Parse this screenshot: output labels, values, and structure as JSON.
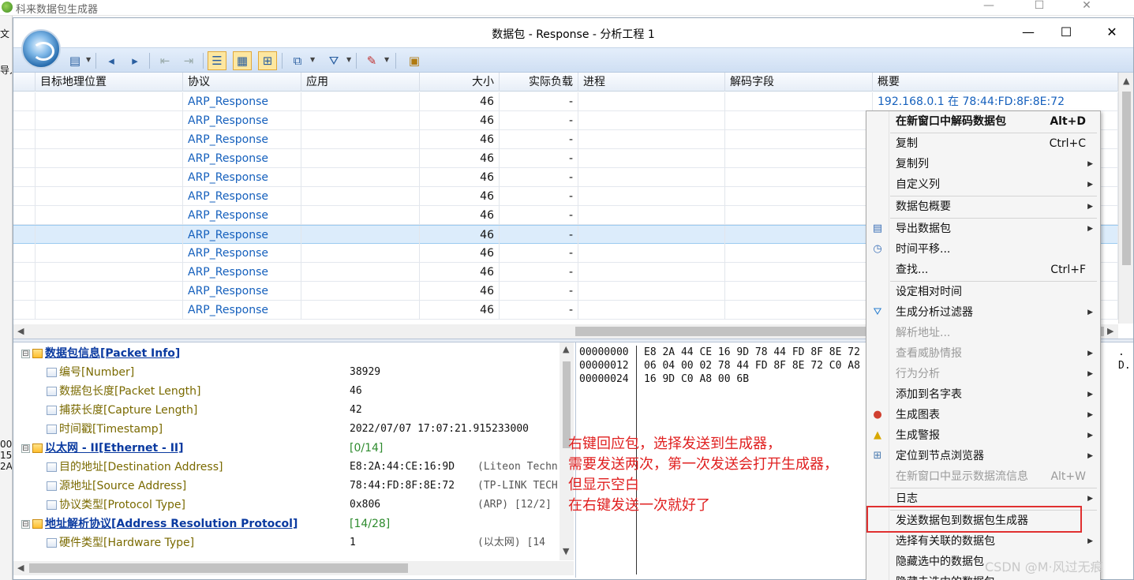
{
  "background_window": {
    "title": "科来数据包生成器",
    "left_labels": [
      "文",
      "导入",
      "00",
      "15",
      "2A"
    ]
  },
  "window": {
    "title": "数据包 - Response - 分析工程 1",
    "minimize": "—",
    "maximize": "☐",
    "close": "✕"
  },
  "packet_list": {
    "columns": [
      "目标地理位置",
      "协议",
      "应用",
      "大小",
      "实际负载",
      "进程",
      "解码字段",
      "概要"
    ],
    "rows": [
      {
        "protocol": "ARP_Response",
        "size": "46",
        "payload": "-",
        "summary": "192.168.0.1 在 78:44:FD:8F:8E:72"
      },
      {
        "protocol": "ARP_Response",
        "size": "46",
        "payload": "-",
        "summary": ""
      },
      {
        "protocol": "ARP_Response",
        "size": "46",
        "payload": "-",
        "summary": ""
      },
      {
        "protocol": "ARP_Response",
        "size": "46",
        "payload": "-",
        "summary": ""
      },
      {
        "protocol": "ARP_Response",
        "size": "46",
        "payload": "-",
        "summary": ""
      },
      {
        "protocol": "ARP_Response",
        "size": "46",
        "payload": "-",
        "summary": ""
      },
      {
        "protocol": "ARP_Response",
        "size": "46",
        "payload": "-",
        "summary": ""
      },
      {
        "protocol": "ARP_Response",
        "size": "46",
        "payload": "-",
        "summary": "",
        "selected": true
      },
      {
        "protocol": "ARP_Response",
        "size": "46",
        "payload": "-",
        "summary": ""
      },
      {
        "protocol": "ARP_Response",
        "size": "46",
        "payload": "-",
        "summary": ""
      },
      {
        "protocol": "ARP_Response",
        "size": "46",
        "payload": "-",
        "summary": ""
      },
      {
        "protocol": "ARP_Response",
        "size": "46",
        "payload": "-",
        "summary": ""
      }
    ]
  },
  "decode_tree": [
    {
      "level": 0,
      "expander": "⊟",
      "header": true,
      "name": "数据包信息[Packet Info]",
      "value": "",
      "desc": "",
      "range": ""
    },
    {
      "level": 1,
      "header": false,
      "name": "编号[Number]",
      "value": "38929",
      "desc": "",
      "range": ""
    },
    {
      "level": 1,
      "header": false,
      "name": "数据包长度[Packet Length]",
      "value": "46",
      "desc": "",
      "range": ""
    },
    {
      "level": 1,
      "header": false,
      "name": "捕获长度[Capture Length]",
      "value": "42",
      "desc": "",
      "range": ""
    },
    {
      "level": 1,
      "header": false,
      "name": "时间戳[Timestamp]",
      "value": "2022/07/07 17:07:21.915233000",
      "desc": "",
      "range": ""
    },
    {
      "level": 0,
      "expander": "⊟",
      "header": true,
      "name": "以太网 - II[Ethernet - II]",
      "value": "",
      "desc": "",
      "range": "[0/14]"
    },
    {
      "level": 1,
      "header": false,
      "name": "目的地址[Destination Address]",
      "value": "E8:2A:44:CE:16:9D",
      "desc": "(Liteon Techn",
      "range": ""
    },
    {
      "level": 1,
      "header": false,
      "name": "源地址[Source Address]",
      "value": "78:44:FD:8F:8E:72",
      "desc": "(TP-LINK TECH",
      "range": ""
    },
    {
      "level": 1,
      "header": false,
      "name": "协议类型[Protocol Type]",
      "value": "0x806",
      "desc": "(ARP)   [12/2]",
      "range": ""
    },
    {
      "level": 0,
      "expander": "⊟",
      "header": true,
      "name": "地址解析协议[Address Resolution Protocol]",
      "value": "",
      "desc": "",
      "range": "[14/28]"
    },
    {
      "level": 1,
      "header": false,
      "name": "硬件类型[Hardware Type]",
      "value": "1",
      "desc": "(以太网)   [14",
      "range": ""
    }
  ],
  "hex_dump": [
    {
      "offset": "00000000",
      "bytes": "E8 2A 44 CE 16 9D 78 44 FD 8F 8E 72",
      "ascii": "."
    },
    {
      "offset": "00000012",
      "bytes": "06 04 00 02 78 44 FD 8F 8E 72 C0 A8",
      "ascii": "D."
    },
    {
      "offset": "00000024",
      "bytes": "16 9D C0 A8 00 6B",
      "ascii": ""
    }
  ],
  "annotation": [
    "右键回应包，选择发送到生成器，",
    "需要发送两次，第一次发送会打开生成器，",
    "但显示空白",
    "在右键发送一次就好了"
  ],
  "context_menu": [
    {
      "label": "在新窗口中解码数据包",
      "shortcut": "Alt+D",
      "bold": true,
      "disabled": false,
      "submenu": false,
      "icon": ""
    },
    {
      "sep": true
    },
    {
      "label": "复制",
      "shortcut": "Ctrl+C",
      "bold": false,
      "disabled": false,
      "submenu": false,
      "icon": ""
    },
    {
      "label": "复制列",
      "shortcut": "",
      "bold": false,
      "disabled": false,
      "submenu": true,
      "icon": ""
    },
    {
      "label": "自定义列",
      "shortcut": "",
      "bold": false,
      "disabled": false,
      "submenu": true,
      "icon": ""
    },
    {
      "sep": true
    },
    {
      "label": "数据包概要",
      "shortcut": "",
      "bold": false,
      "disabled": false,
      "submenu": true,
      "icon": ""
    },
    {
      "sep": true
    },
    {
      "label": "导出数据包",
      "shortcut": "",
      "bold": false,
      "disabled": false,
      "submenu": true,
      "icon": "export-icon"
    },
    {
      "label": "时间平移...",
      "shortcut": "",
      "bold": false,
      "disabled": false,
      "submenu": false,
      "icon": "clock-icon"
    },
    {
      "label": "查找...",
      "shortcut": "Ctrl+F",
      "bold": false,
      "disabled": false,
      "submenu": false,
      "icon": ""
    },
    {
      "sep": true
    },
    {
      "label": "设定相对时间",
      "shortcut": "",
      "bold": false,
      "disabled": false,
      "submenu": false,
      "icon": ""
    },
    {
      "label": "生成分析过滤器",
      "shortcut": "",
      "bold": false,
      "disabled": false,
      "submenu": true,
      "icon": "filter-icon"
    },
    {
      "label": "解析地址...",
      "shortcut": "",
      "bold": false,
      "disabled": true,
      "submenu": false,
      "icon": ""
    },
    {
      "label": "查看威胁情报",
      "shortcut": "",
      "bold": false,
      "disabled": true,
      "submenu": true,
      "icon": ""
    },
    {
      "label": "行为分析",
      "shortcut": "",
      "bold": false,
      "disabled": true,
      "submenu": true,
      "icon": ""
    },
    {
      "label": "添加到名字表",
      "shortcut": "",
      "bold": false,
      "disabled": false,
      "submenu": true,
      "icon": ""
    },
    {
      "label": "生成图表",
      "shortcut": "",
      "bold": false,
      "disabled": false,
      "submenu": true,
      "icon": "chart-icon"
    },
    {
      "label": "生成警报",
      "shortcut": "",
      "bold": false,
      "disabled": false,
      "submenu": true,
      "icon": "alert-icon"
    },
    {
      "label": "定位到节点浏览器",
      "shortcut": "",
      "bold": false,
      "disabled": false,
      "submenu": true,
      "icon": "node-icon"
    },
    {
      "label": "在新窗口中显示数据流信息",
      "shortcut": "Alt+W",
      "bold": false,
      "disabled": true,
      "submenu": false,
      "icon": ""
    },
    {
      "sep": true
    },
    {
      "label": "日志",
      "shortcut": "",
      "bold": false,
      "disabled": false,
      "submenu": true,
      "icon": ""
    },
    {
      "sep": true
    },
    {
      "label": "发送数据包到数据包生成器",
      "shortcut": "",
      "bold": false,
      "disabled": false,
      "submenu": false,
      "icon": "",
      "highlighted": true
    },
    {
      "label": "选择有关联的数据包",
      "shortcut": "",
      "bold": false,
      "disabled": false,
      "submenu": true,
      "icon": ""
    },
    {
      "label": "隐藏选中的数据包",
      "shortcut": "",
      "bold": false,
      "disabled": false,
      "submenu": false,
      "icon": ""
    },
    {
      "label": "隐藏未选中的数据包",
      "shortcut": "",
      "bold": false,
      "disabled": false,
      "submenu": false,
      "icon": ""
    }
  ],
  "watermark": "CSDN @M·风过无痕"
}
